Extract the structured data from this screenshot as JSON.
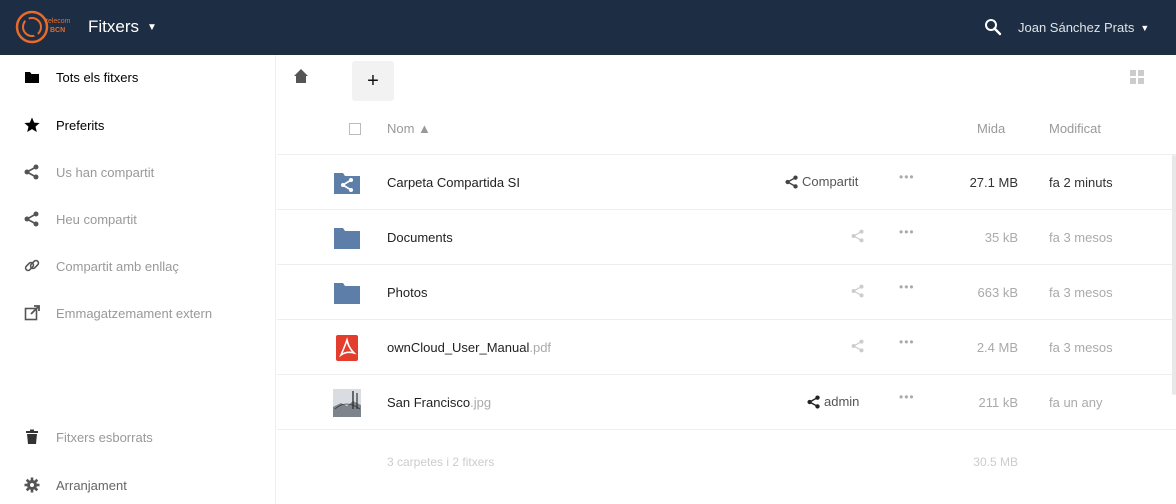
{
  "header": {
    "logo_text": "telecom BCN",
    "app_name": "Fitxers",
    "user_name": "Joan Sánchez Prats",
    "bg_color": "#1d2d44"
  },
  "sidebar": {
    "items": [
      {
        "label": "Tots els fitxers",
        "icon": "folder-icon"
      },
      {
        "label": "Preferits",
        "icon": "star-icon"
      },
      {
        "label": "Us han compartit",
        "icon": "share-icon"
      },
      {
        "label": "Heu compartit",
        "icon": "share-icon"
      },
      {
        "label": "Compartit amb enllaç",
        "icon": "link-icon"
      },
      {
        "label": "Emmagatzemament extern",
        "icon": "external-icon"
      },
      {
        "label": "Fitxers esborrats",
        "icon": "trash-icon"
      },
      {
        "label": "Arranjament",
        "icon": "gear-icon"
      }
    ]
  },
  "controls": {
    "add_label": "+"
  },
  "table": {
    "headers": {
      "name": "Nom ▲",
      "size": "Mida",
      "modified": "Modificat"
    },
    "rows": [
      {
        "name": "Carpeta Compartida SI",
        "ext": "",
        "share": "Compartit",
        "size": "27.1 MB",
        "modified": "fa 2 minuts",
        "type": "shared-folder"
      },
      {
        "name": "Documents",
        "ext": "",
        "share": "",
        "size": "35 kB",
        "modified": "fa 3 mesos",
        "type": "folder"
      },
      {
        "name": "Photos",
        "ext": "",
        "share": "",
        "size": "663 kB",
        "modified": "fa 3 mesos",
        "type": "folder"
      },
      {
        "name": "ownCloud_User_Manual",
        "ext": ".pdf",
        "share": "",
        "size": "2.4 MB",
        "modified": "fa 3 mesos",
        "type": "pdf"
      },
      {
        "name": "San Francisco",
        "ext": ".jpg",
        "share": "admin",
        "size": "211 kB",
        "modified": "fa un any",
        "type": "image"
      }
    ],
    "dots": "•••",
    "summary_count": "3 carpetes i 2 fitxers",
    "summary_size": "30.5 MB"
  },
  "colors": {
    "folder": "#5d7ea8",
    "pdf": "#e23d2d",
    "header": "#1d2d44"
  }
}
